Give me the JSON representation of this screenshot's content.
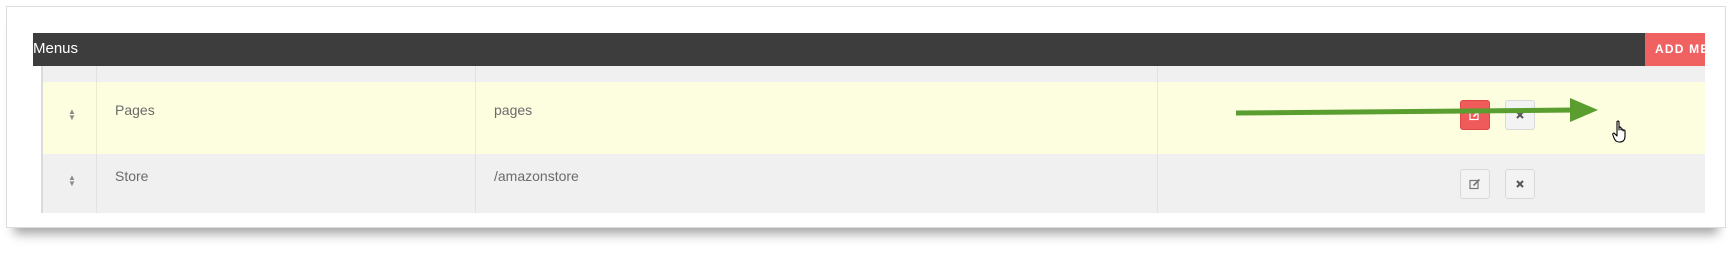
{
  "panel": {
    "title": "Menus",
    "add_button_label": "ADD MENU"
  },
  "rows": [
    {
      "name": "Pages",
      "link": "pages",
      "highlighted": true,
      "actions": [
        "edit-icon",
        "close-icon"
      ]
    },
    {
      "name": "Store",
      "link": "/amazonstore",
      "highlighted": false,
      "actions": [
        "edit-icon",
        "close-icon"
      ]
    }
  ],
  "colors": {
    "header_bg": "#3d3d3d",
    "accent": "#f06262",
    "highlight_row": "#fdfde0",
    "arrow": "#5a9e2f"
  },
  "icons": {
    "sort": "sort-icon",
    "edit": "edit-icon",
    "delete": "close-icon",
    "cursor": "hand-pointer-icon"
  }
}
